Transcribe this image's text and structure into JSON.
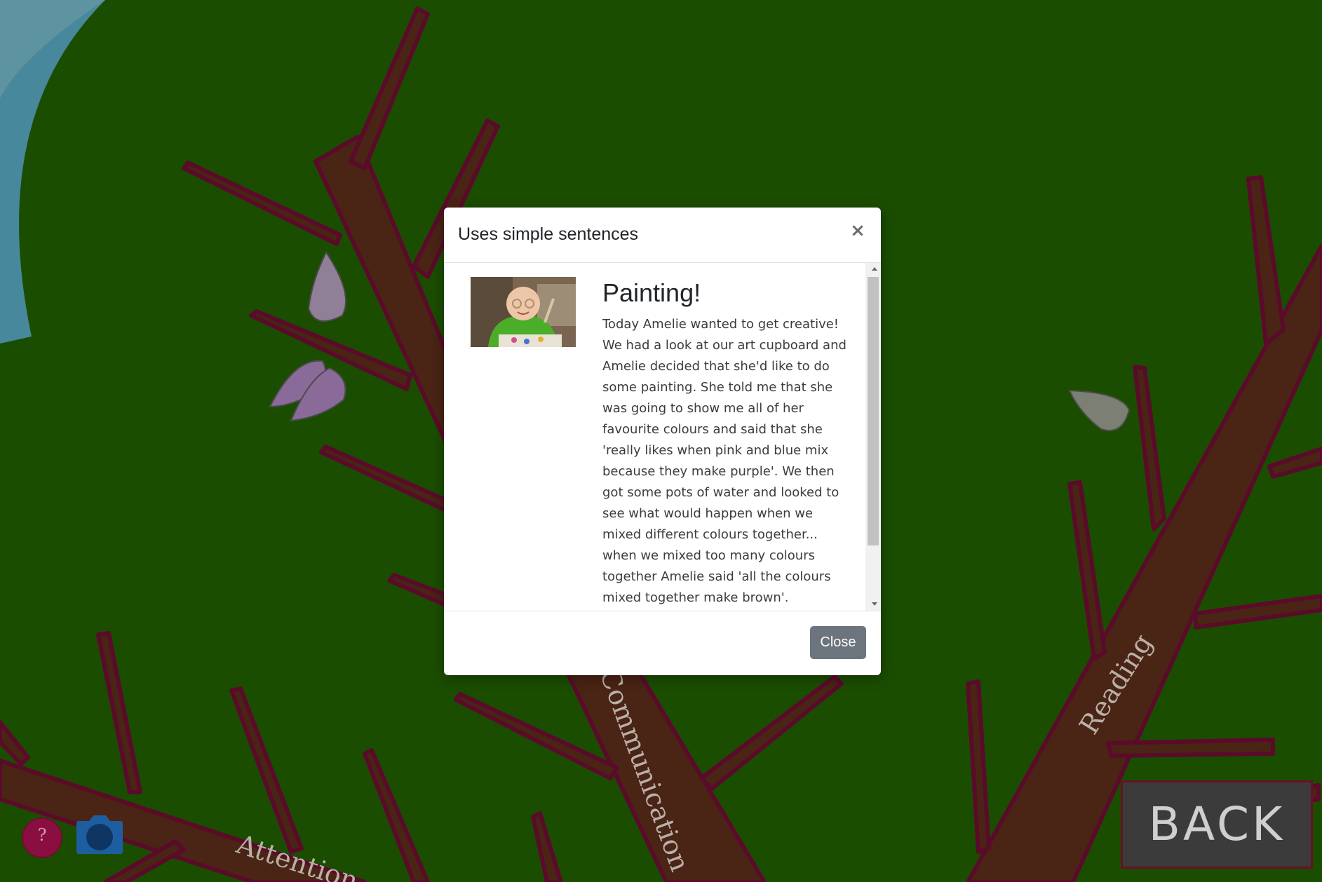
{
  "scene": {
    "branch_labels": [
      "Communication",
      "Reading",
      "Attention"
    ]
  },
  "modal": {
    "title": "Uses simple sentences",
    "close_symbol": "×",
    "story_title": "Painting!",
    "story_text": "Today Amelie wanted to get creative! We had a look at our art cupboard and Amelie decided that she'd like to do some painting. She told me that she was going to show me all of her favourite colours and said that she 'really likes when pink and blue mix because they make purple'. We then got some pots of water and looked to see what would happen when we mixed different colours together... when we mixed too many colours together Amelie said 'all the colours mixed together make brown'.",
    "close_button_label": "Close"
  },
  "controls": {
    "help_symbol": "?",
    "back_label": "BACK"
  },
  "colors": {
    "background": "#1b4d00",
    "branch": "#4a2414",
    "branch_outline": "#5a0b2a",
    "modal_button": "#6c757d",
    "help_button": "#8a0f40",
    "camera": "#1d5ea0"
  },
  "icons": [
    "help-icon",
    "camera-icon",
    "close-icon"
  ]
}
